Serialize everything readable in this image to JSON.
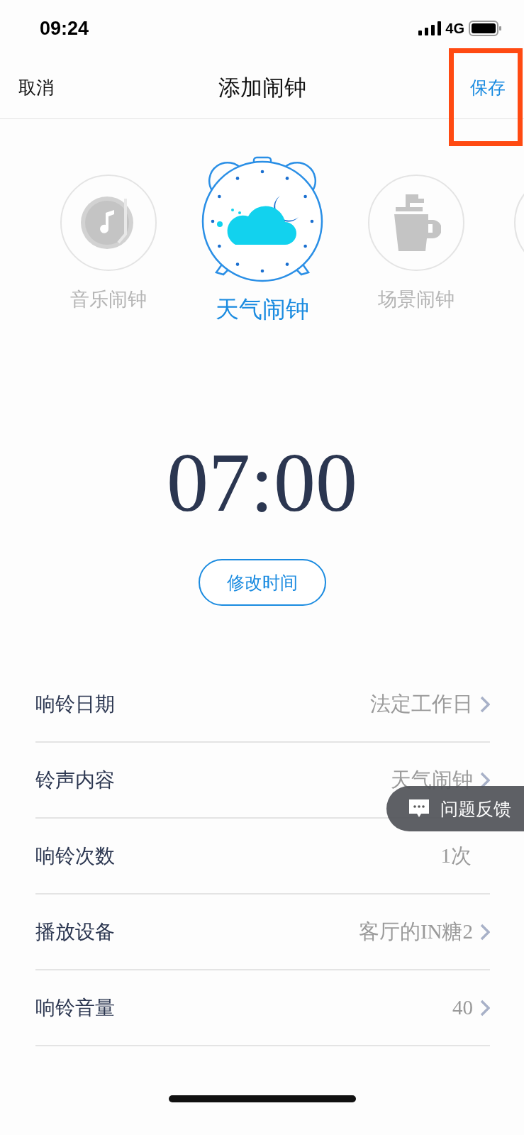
{
  "status_bar": {
    "time": "09:24",
    "network": "4G"
  },
  "nav": {
    "cancel": "取消",
    "title": "添加闹钟",
    "save": {
      "label": "保存",
      "highlighted": true
    }
  },
  "alarm_types": [
    {
      "kind": "music",
      "label": "音乐闹钟",
      "selected": false
    },
    {
      "kind": "weather",
      "label": "天气闹钟",
      "selected": true
    },
    {
      "kind": "scene",
      "label": "场景闹钟",
      "selected": false
    },
    {
      "kind": "partial"
    }
  ],
  "time": "07:00",
  "edit_time_button": "修改时间",
  "settings": [
    {
      "label": "响铃日期",
      "value": "法定工作日",
      "chevron": true
    },
    {
      "label": "铃声内容",
      "value": "天气闹钟",
      "chevron": true
    },
    {
      "label": "响铃次数",
      "value": "1次",
      "chevron": false
    },
    {
      "label": "播放设备",
      "value": "客厅的IN糖2",
      "chevron": true
    },
    {
      "label": "响铃音量",
      "value": "40",
      "chevron": true
    }
  ],
  "feedback_button": "问题反馈"
}
